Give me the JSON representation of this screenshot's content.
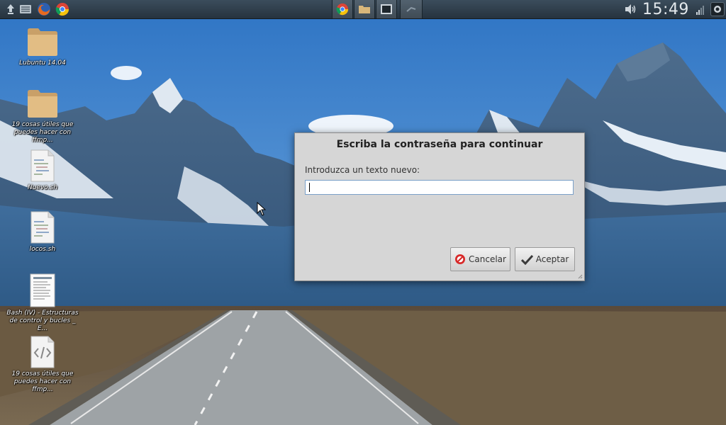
{
  "panel": {
    "clock": "15:49",
    "launchers": [
      "menu-icon",
      "file-manager-icon",
      "firefox-icon",
      "chrome-icon"
    ],
    "tasks": [
      "chrome-icon",
      "folder-icon",
      "terminal-icon",
      "dialog-icon"
    ]
  },
  "desktop": {
    "icons": [
      {
        "label": "Lubuntu 14.04",
        "type": "folder"
      },
      {
        "label": "19 cosas útiles que\npuedes hacer con ffmp...",
        "type": "folder"
      },
      {
        "label": "Nuevo.sh",
        "type": "script"
      },
      {
        "label": "locos.sh",
        "type": "script"
      },
      {
        "label": "Bash (IV) - Estructuras\nde control y bucles _ E...",
        "type": "document"
      },
      {
        "label": "19 cosas útiles que\npuedes hacer con ffmp...",
        "type": "html"
      }
    ]
  },
  "dialog": {
    "title": "Escriba la contraseña para continuar",
    "prompt": "Introduzca un texto nuevo:",
    "input_value": "",
    "cancel_label": "Cancelar",
    "ok_label": "Aceptar"
  },
  "colors": {
    "panel": "#2c3a46",
    "dialog_bg": "#d6d6d6",
    "input_border": "#7aa0c8"
  }
}
